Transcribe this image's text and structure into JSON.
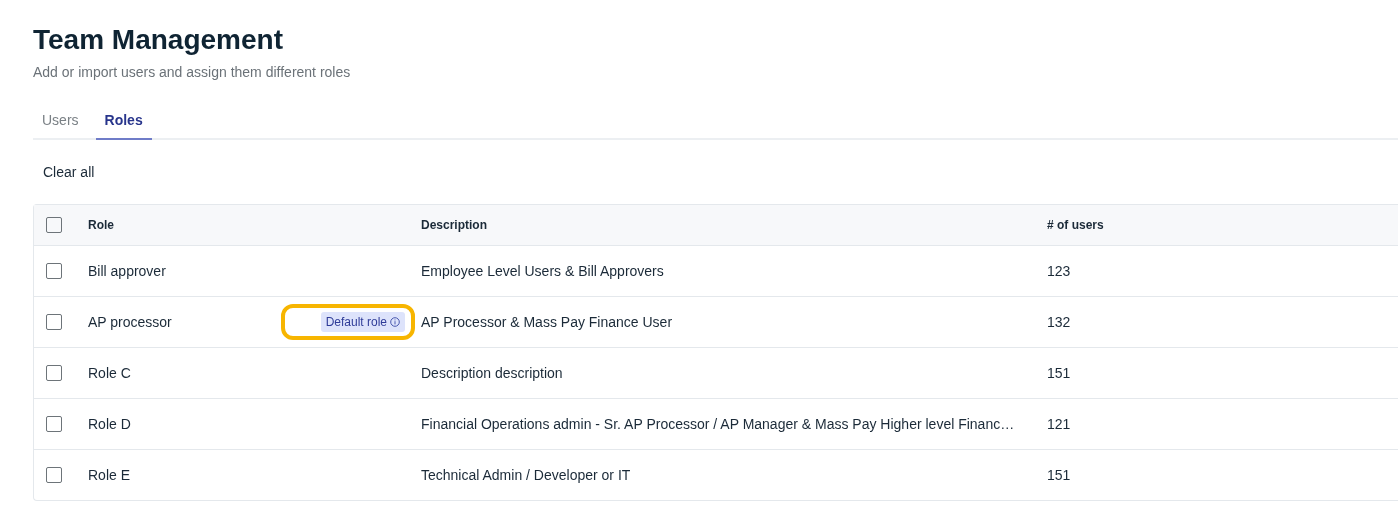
{
  "page": {
    "title": "Team Management",
    "subtitle": "Add or import users and assign them different roles"
  },
  "tabs": [
    {
      "label": "Users",
      "selected": false
    },
    {
      "label": "Roles",
      "selected": true
    }
  ],
  "clear_all": "Clear all",
  "table": {
    "header_checked": false,
    "columns": [
      "Role",
      "Description",
      "# of users"
    ],
    "rows": [
      {
        "checked": false,
        "role": "Bill approver",
        "description": "Employee Level Users & Bill Approvers",
        "users": "123"
      },
      {
        "checked": false,
        "role": "AP processor",
        "badge": {
          "label": "Default role",
          "highlighted": true
        },
        "description": "AP Processor & Mass Pay Finance User",
        "users": "132"
      },
      {
        "checked": false,
        "role": "Role C",
        "description": "Description description",
        "users": "151"
      },
      {
        "checked": false,
        "role": "Role D",
        "description": "Financial Operations admin - Sr. AP Processor / AP Manager & Mass Pay Higher level Financ…",
        "users": "121"
      },
      {
        "checked": false,
        "role": "Role E",
        "description": "Technical Admin / Developer or IT",
        "users": "151"
      }
    ]
  }
}
